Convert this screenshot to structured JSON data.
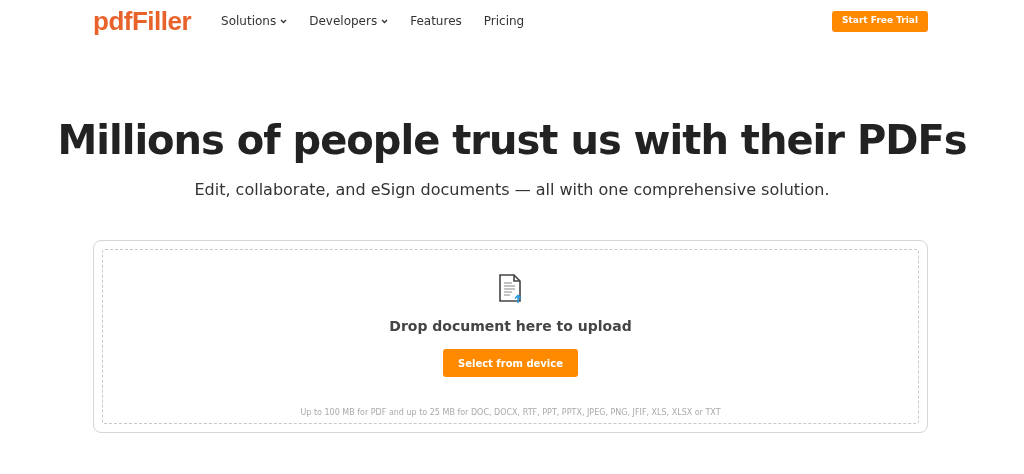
{
  "header": {
    "logo": "pdfFiller",
    "nav": [
      {
        "label": "Solutions",
        "has_menu": true
      },
      {
        "label": "Developers",
        "has_menu": true
      },
      {
        "label": "Features",
        "has_menu": false
      },
      {
        "label": "Pricing",
        "has_menu": false
      }
    ],
    "cta": "Start Free Trial"
  },
  "hero": {
    "title": "Millions of people trust us with their PDFs",
    "subtitle": "Edit, collaborate, and eSign documents — all with one comprehensive solution."
  },
  "upload": {
    "prompt": "Drop document here to upload",
    "button": "Select from device",
    "note": "Up to 100 MB for PDF and up to 25 MB for DOC, DOCX, RTF, PPT, PPTX, JPEG, PNG, JFIF, XLS, XLSX or TXT"
  }
}
